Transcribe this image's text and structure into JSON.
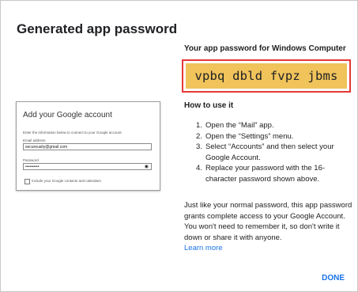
{
  "dialog": {
    "title": "Generated app password",
    "password_heading": "Your app password for Windows Computer",
    "password": "vpbq dbld fvpz jbms",
    "how_heading": "How to use it",
    "steps": [
      {
        "num": "1.",
        "text": "Open the “Mail” app."
      },
      {
        "num": "2.",
        "text": "Open the “Settings” menu."
      },
      {
        "num": "3.",
        "text": "Select “Accounts” and then select your Google Account."
      },
      {
        "num": "4.",
        "text": "Replace your password with the 16-character password shown above."
      }
    ],
    "info_text": "Just like your normal password, this app password grants complete access to your Google Account. You won't need to remember it, so don't write it down or share it with anyone.",
    "learn_more": "Learn more",
    "done_label": "DONE"
  },
  "mock_account": {
    "title": "Add your Google account",
    "description": "Enter the information below to connect to your Google account.",
    "email_label": "Email address",
    "email_value": "secureusity@gmail.com",
    "password_label": "Password",
    "password_value": "••••••••••",
    "eye_icon": "eye-icon",
    "checkbox_label": "Include your Google contacts and calendars"
  },
  "colors": {
    "accent": "#1a73e8",
    "password_bg": "#f0c35b",
    "highlight_border": "#e53935"
  }
}
